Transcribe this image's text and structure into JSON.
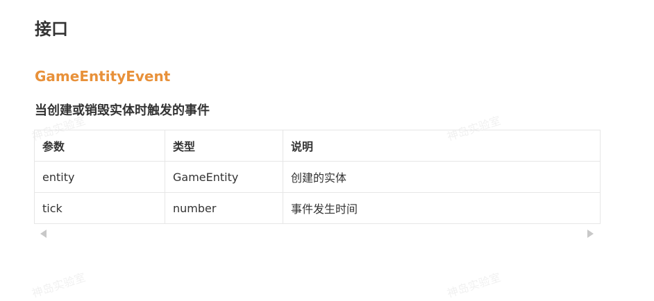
{
  "page": {
    "title": "接口"
  },
  "interface": {
    "name": "GameEntityEvent",
    "description": "当创建或销毁实体时触发的事件",
    "accent_color": "#e8913a"
  },
  "table": {
    "headers": [
      "参数",
      "类型",
      "说明"
    ],
    "rows": [
      [
        "entity",
        "GameEntity",
        "创建的实体"
      ],
      [
        "tick",
        "number",
        "事件发生时间"
      ]
    ]
  },
  "watermark": {
    "text": "神岛实验室"
  },
  "scrollbar": {
    "left_icon": "triangle-left-icon",
    "right_icon": "triangle-right-icon"
  }
}
